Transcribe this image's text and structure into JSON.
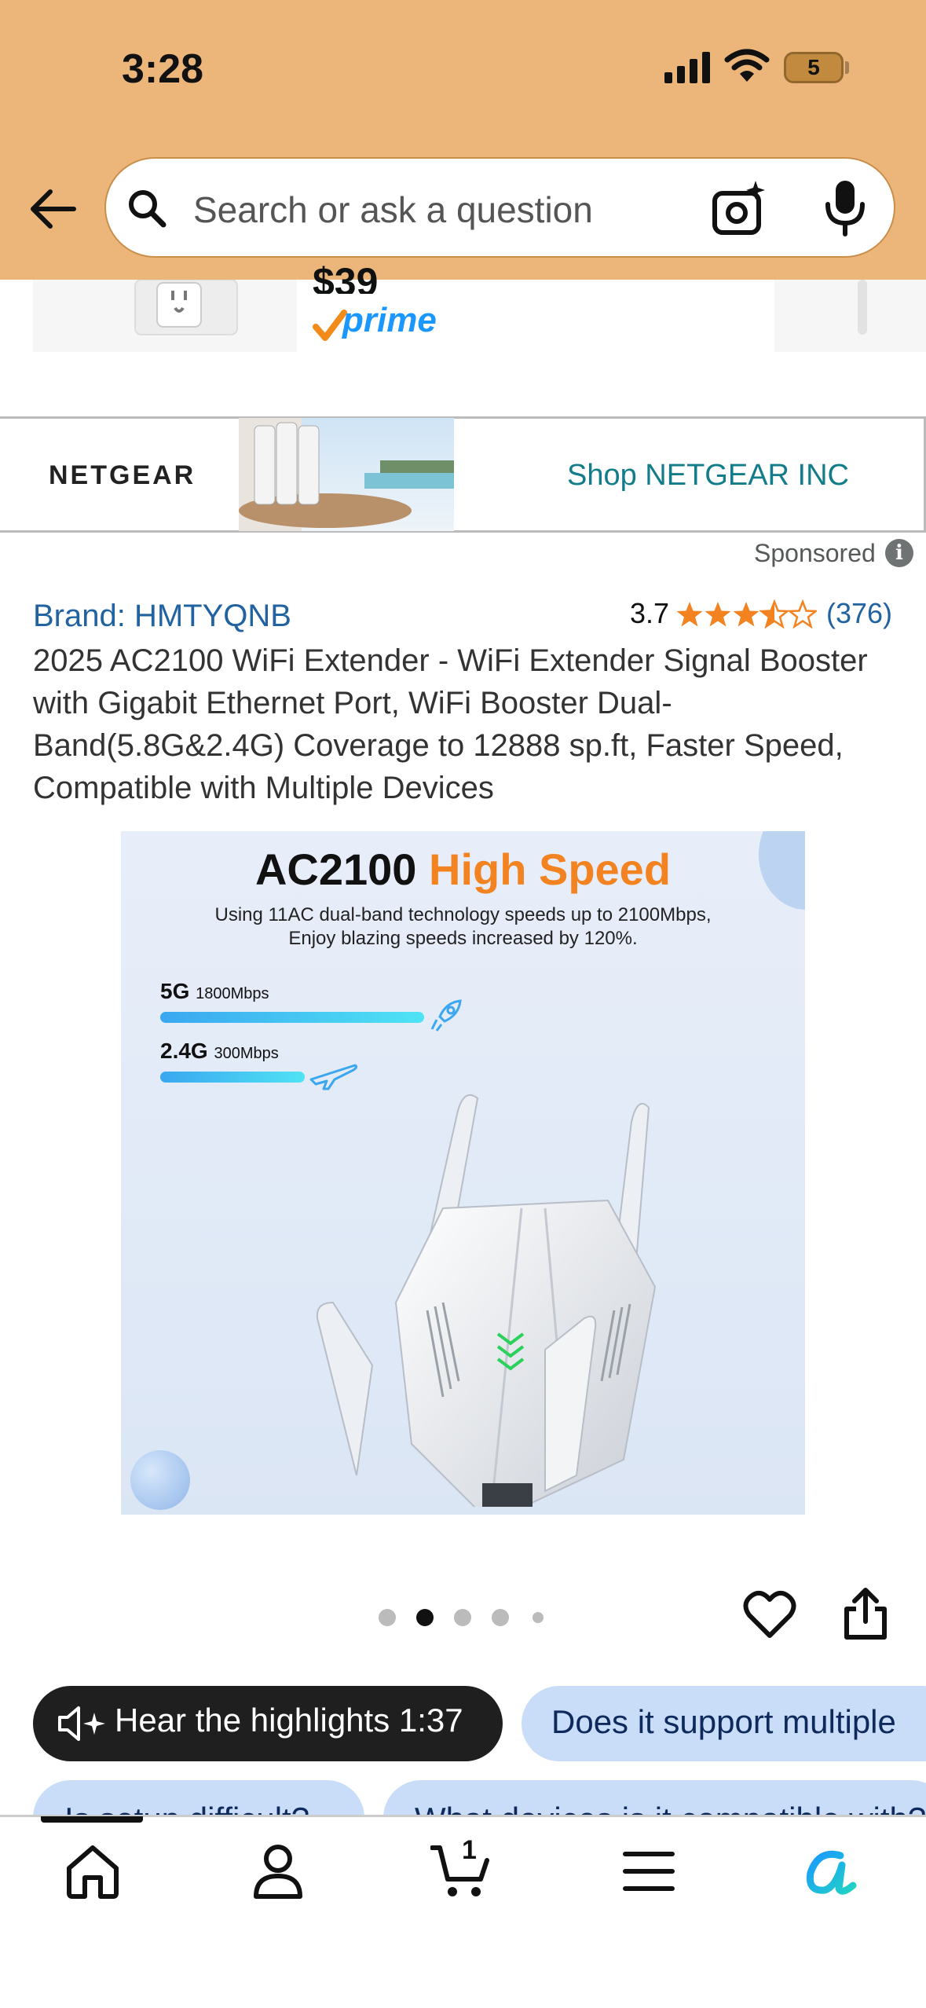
{
  "status_bar": {
    "time": "3:28",
    "battery": "5"
  },
  "search": {
    "placeholder": "Search or ask a question"
  },
  "prev_product": {
    "price": "$39",
    "badge": "prime"
  },
  "banner": {
    "logo": "NETGEAR",
    "link": "Shop NETGEAR INC",
    "sponsored": "Sponsored"
  },
  "product": {
    "brand": "Brand: HMTYQNB",
    "rating": "3.7",
    "rating_value": 3.7,
    "review_count": "(376)",
    "title": "2025 AC2100 WiFi Extender - WiFi Extender Signal Booster with Gigabit Ethernet Port, WiFi Booster Dual-Band(5.8G&2.4G) Coverage to 12888 sp.ft, Faster Speed, Compatible with Multiple Devices",
    "image": {
      "headline_a": "AC2100 ",
      "headline_b": "High Speed",
      "subtitle_1": "Using 11AC dual-band technology speeds up to 2100Mbps,",
      "subtitle_2": "Enjoy blazing speeds increased by 120%.",
      "band_5g": "5G",
      "band_5g_speed": "1800Mbps",
      "band_24g": "2.4G",
      "band_24g_speed": "300Mbps"
    },
    "carousel": {
      "count": 5,
      "active": 2
    }
  },
  "chips": {
    "hear": "Hear the highlights 1:37",
    "question_1": "Does it support multiple",
    "question_2": "Is setup difficult?",
    "question_3": "What devices is it compatible with?"
  },
  "nav": {
    "cart_count": "1",
    "items": [
      "home-icon",
      "account-icon",
      "cart-icon",
      "menu-icon",
      "rufus-icon"
    ]
  },
  "colors": {
    "header_bg": "#ecb57a",
    "link": "#2162a1",
    "star": "#f28320",
    "chip_bg": "#c9ddf8"
  }
}
